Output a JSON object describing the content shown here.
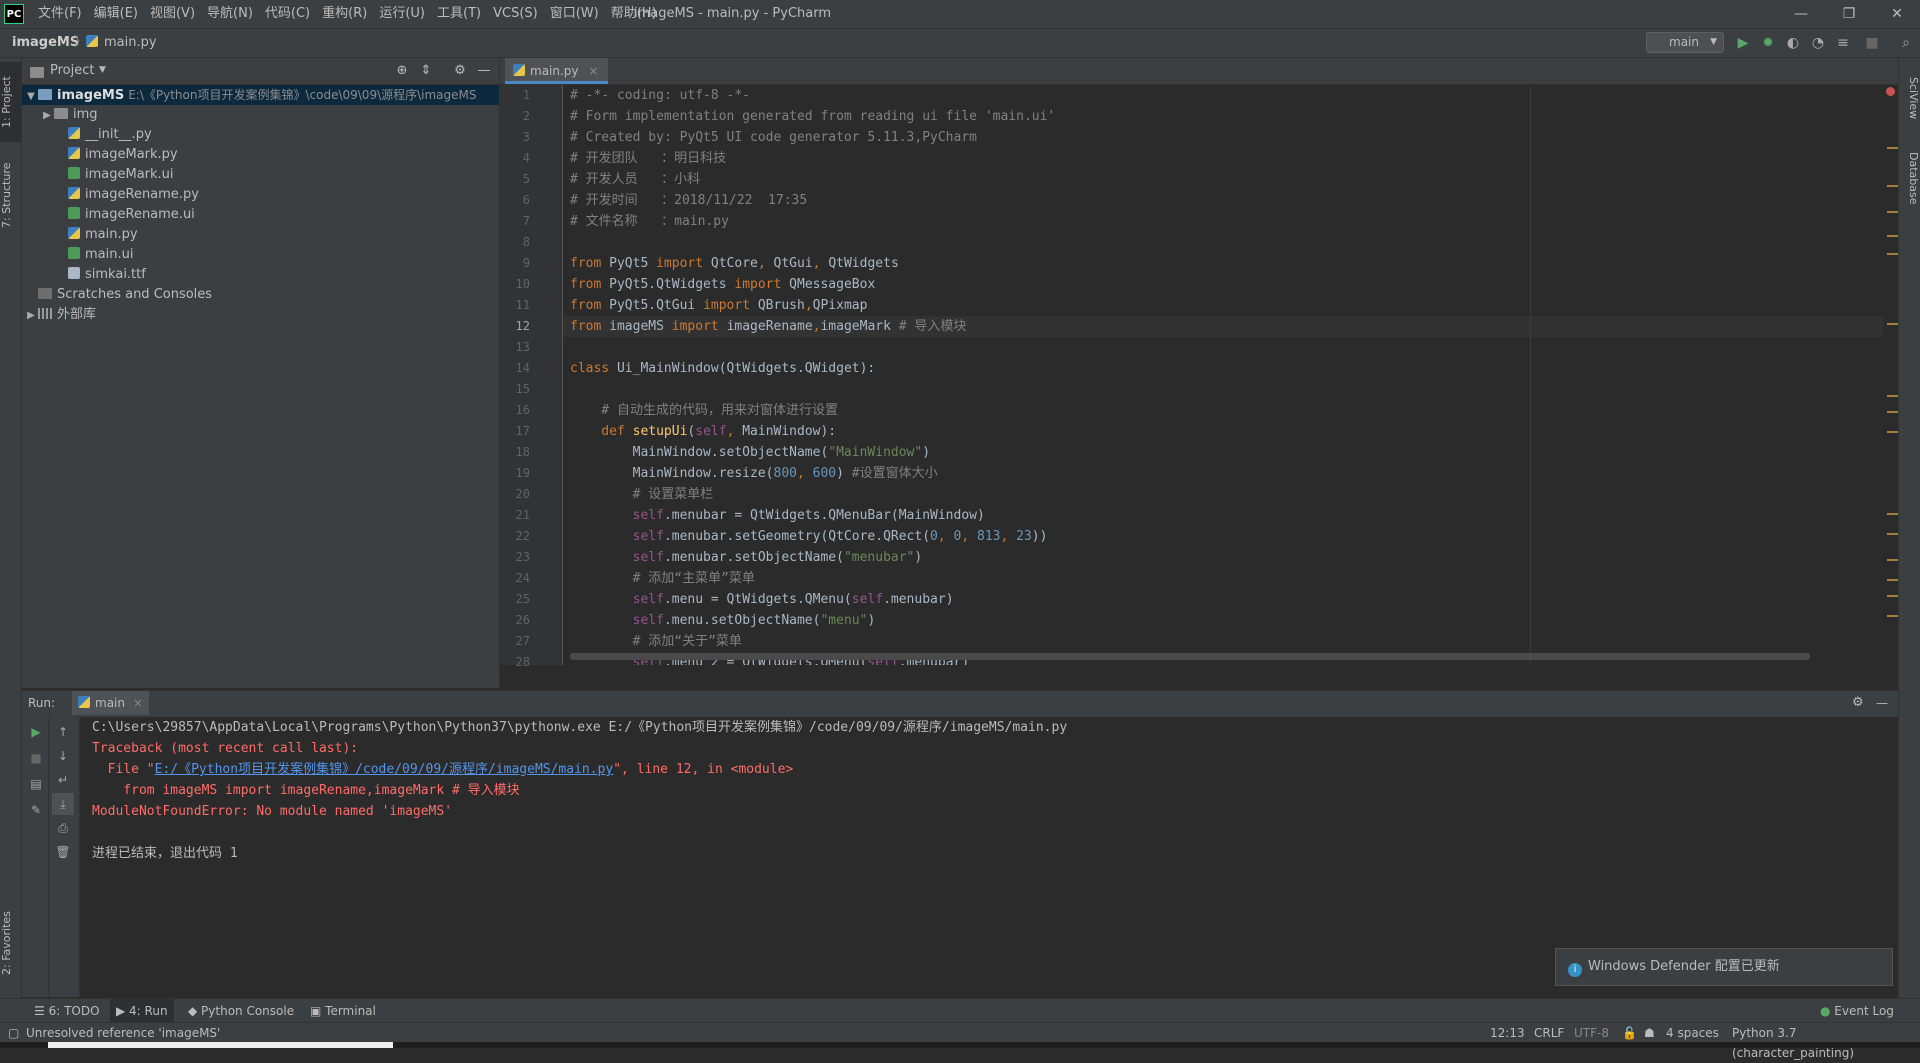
{
  "window": {
    "logo": "PC",
    "title": "imageMS - main.py - PyCharm",
    "menu": [
      "文件(F)",
      "编辑(E)",
      "视图(V)",
      "导航(N)",
      "代码(C)",
      "重构(R)",
      "运行(U)",
      "工具(T)",
      "VCS(S)",
      "窗口(W)",
      "帮助(H)"
    ],
    "minimize": "—",
    "restore": "❐",
    "close": "✕"
  },
  "navbar": {
    "project": "imageMS",
    "file": "main.py",
    "run_config": "main"
  },
  "left_stripe": {
    "project_tab": "1: Project",
    "structure_tab": "7: Structure",
    "favorites_tab": "2: Favorites"
  },
  "right_stripe": {
    "sciview_tab": "SciView",
    "database_tab": "Database"
  },
  "project_panel": {
    "title": "Project",
    "root_name": "imageMS",
    "root_path": "E:\\《Python项目开发案例集锦》\\code\\09\\09\\源程序\\imageMS",
    "items": [
      {
        "name": "img",
        "type": "folder"
      },
      {
        "name": "__init__.py",
        "type": "py"
      },
      {
        "name": "imageMark.py",
        "type": "py"
      },
      {
        "name": "imageMark.ui",
        "type": "ui"
      },
      {
        "name": "imageRename.py",
        "type": "py"
      },
      {
        "name": "imageRename.ui",
        "type": "ui"
      },
      {
        "name": "main.py",
        "type": "py"
      },
      {
        "name": "main.ui",
        "type": "ui"
      },
      {
        "name": "simkai.ttf",
        "type": "ttf"
      }
    ],
    "scratches": "Scratches and Consoles",
    "external_libs": "外部库"
  },
  "editor": {
    "tab": "main.py",
    "current_line": 12,
    "line_numbers": [
      "1",
      "2",
      "3",
      "4",
      "5",
      "6",
      "7",
      "8",
      "9",
      "10",
      "11",
      "12",
      "13",
      "14",
      "15",
      "16",
      "17",
      "18",
      "19",
      "20",
      "21",
      "22",
      "23",
      "24",
      "25",
      "26",
      "27",
      "28"
    ]
  },
  "run_panel": {
    "label": "Run:",
    "tab": "main",
    "lines": {
      "cmd": "C:\\Users\\29857\\AppData\\Local\\Programs\\Python\\Python37\\pythonw.exe E:/《Python项目开发案例集锦》/code/09/09/源程序/imageMS/main.py",
      "traceback": "Traceback (most recent call last):",
      "file_prefix": "  File \"",
      "file_link": "E:/《Python项目开发案例集锦》/code/09/09/源程序/imageMS/main.py",
      "file_suffix": "\", line 12, in <module>",
      "source": "    from imageMS import imageRename,imageMark # 导入模块",
      "error": "ModuleNotFoundError: No module named 'imageMS'",
      "exit": "进程已结束，退出代码 1"
    }
  },
  "notification": "Windows Defender 配置已更新",
  "bottom_tabs": {
    "todo": "6: TODO",
    "run": "4: Run",
    "python_console": "Python Console",
    "terminal": "Terminal",
    "event_log": "Event Log"
  },
  "status": {
    "message": "Unresolved reference 'imageMS'",
    "position": "12:13",
    "line_sep": "CRLF",
    "encoding": "UTF-8",
    "indent": "4 spaces",
    "interpreter": "Python 3.7 (character_painting)"
  }
}
